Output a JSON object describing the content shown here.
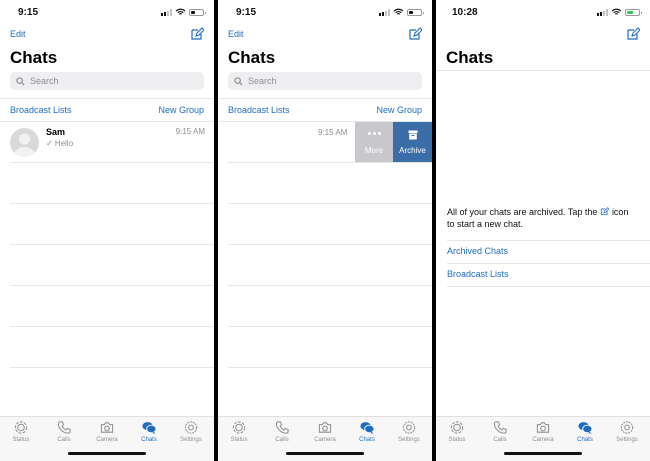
{
  "colors": {
    "accent": "#1f6cc0",
    "archive": "#3b6ea8",
    "more": "#c7c7cc",
    "battery_green": "#34c759"
  },
  "screen1": {
    "time": "9:15",
    "edit": "Edit",
    "title": "Chats",
    "search_placeholder": "Search",
    "broadcast": "Broadcast Lists",
    "new_group": "New Group",
    "chat": {
      "name": "Sam",
      "time": "9:15 AM",
      "message": "✓ Hello"
    }
  },
  "screen2": {
    "time": "9:15",
    "edit": "Edit",
    "title": "Chats",
    "search_placeholder": "Search",
    "broadcast": "Broadcast Lists",
    "new_group": "New Group",
    "chat_time": "9:15 AM",
    "more": "More",
    "archive": "Archive"
  },
  "screen3": {
    "time": "10:28",
    "title": "Chats",
    "message_a": "All of your chats are archived. Tap the",
    "message_b": "icon to start a new chat.",
    "archived_chats": "Archived Chats",
    "broadcast": "Broadcast Lists"
  },
  "tabs": [
    "Status",
    "Calls",
    "Camera",
    "Chats",
    "Settings"
  ],
  "active_tab": "Chats",
  "icons": [
    "signal-icon",
    "wifi-icon",
    "battery-icon",
    "compose-icon",
    "search-icon",
    "avatar-icon",
    "more-icon",
    "archive-icon",
    "status-icon",
    "calls-icon",
    "camera-icon",
    "chats-icon",
    "settings-icon"
  ]
}
